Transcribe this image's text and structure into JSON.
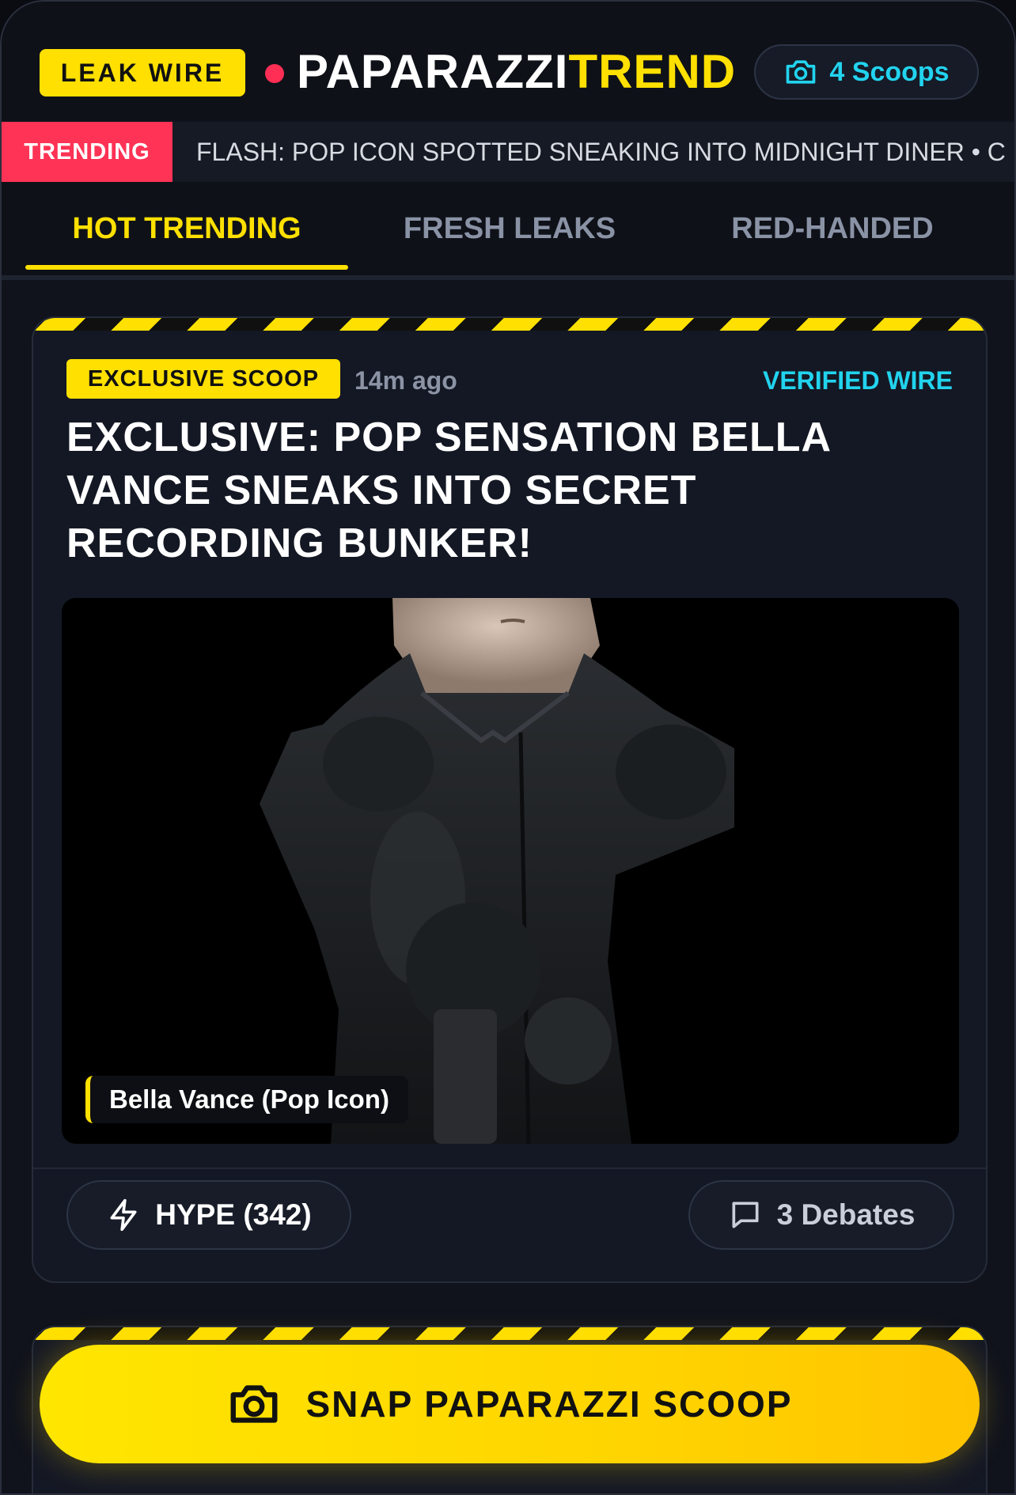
{
  "header": {
    "badge": "LEAK WIRE",
    "brand_part1": "PAPARAZZI",
    "brand_part2": "TREND",
    "scoops_label": "4 Scoops"
  },
  "ticker": {
    "label": "TRENDING",
    "text": "FLASH: POP ICON SPOTTED SNEAKING INTO MIDNIGHT DINER • C"
  },
  "tabs": [
    {
      "label": "HOT TRENDING",
      "active": true
    },
    {
      "label": "FRESH LEAKS",
      "active": false
    },
    {
      "label": "RED-HANDED",
      "active": false
    }
  ],
  "post": {
    "tag": "EXCLUSIVE SCOOP",
    "time": "14m ago",
    "source": "VERIFIED WIRE",
    "headline": "EXCLUSIVE: POP SENSATION BELLA VANCE SNEAKS INTO SECRET RECORDING BUNKER!",
    "image_caption": "Bella Vance (Pop Icon)",
    "hype_label": "HYPE (342)",
    "debates_label": "3 Debates"
  },
  "cta": {
    "label": "SNAP PAPARAZZI SCOOP"
  },
  "colors": {
    "accent": "#ffe000",
    "live": "#ff2e55",
    "ticker_label_bg": "#ff3355",
    "cyan": "#22d3ee",
    "background": "#10131c"
  },
  "icons": {
    "scoops": "camera-icon",
    "hype": "lightning-icon",
    "debates": "comment-icon",
    "cta": "camera-icon"
  }
}
